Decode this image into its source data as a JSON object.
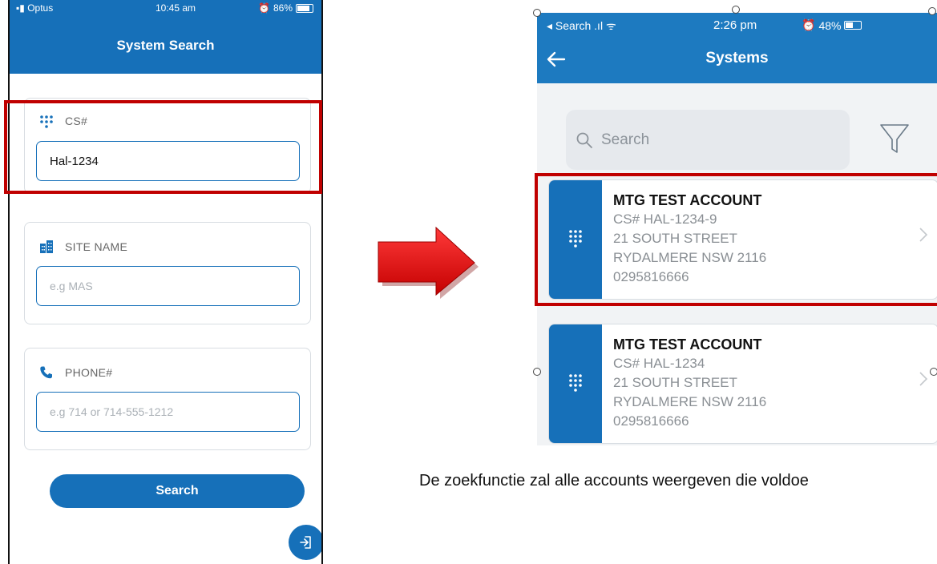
{
  "left_phone": {
    "status": {
      "carrier": "Optus",
      "time": "10:45 am",
      "battery": "86%"
    },
    "title": "System Search",
    "fields": [
      {
        "label": "CS#",
        "value": "Hal-1234",
        "placeholder": ""
      },
      {
        "label": "SITE NAME",
        "value": "",
        "placeholder": "e.g MAS"
      },
      {
        "label": "PHONE#",
        "value": "",
        "placeholder": "e.g 714 or 714-555-1212"
      }
    ],
    "search_button": "Search"
  },
  "right_phone": {
    "status": {
      "back_label": "Search",
      "time": "2:26 pm",
      "battery": "48%"
    },
    "title": "Systems",
    "search_placeholder": "Search",
    "accounts": [
      {
        "name": "MTG TEST ACCOUNT",
        "cs": "CS# HAL-1234-9",
        "street": "21 SOUTH STREET",
        "suburb": "RYDALMERE NSW 2116",
        "phone": "0295816666"
      },
      {
        "name": "MTG TEST ACCOUNT",
        "cs": "CS# HAL-1234",
        "street": "21 SOUTH STREET",
        "suburb": "RYDALMERE NSW 2116",
        "phone": "0295816666"
      }
    ]
  },
  "caption": "De zoekfunctie zal alle accounts weergeven die voldoe",
  "colors": {
    "brand_blue": "#1670b9",
    "highlight_red": "#c00000",
    "arrow_red": "#e00000"
  },
  "icons": [
    "keypad-icon",
    "building-icon",
    "phone-icon",
    "logout-icon",
    "back-arrow-icon",
    "search-icon",
    "filter-icon",
    "chevron-right-icon"
  ]
}
